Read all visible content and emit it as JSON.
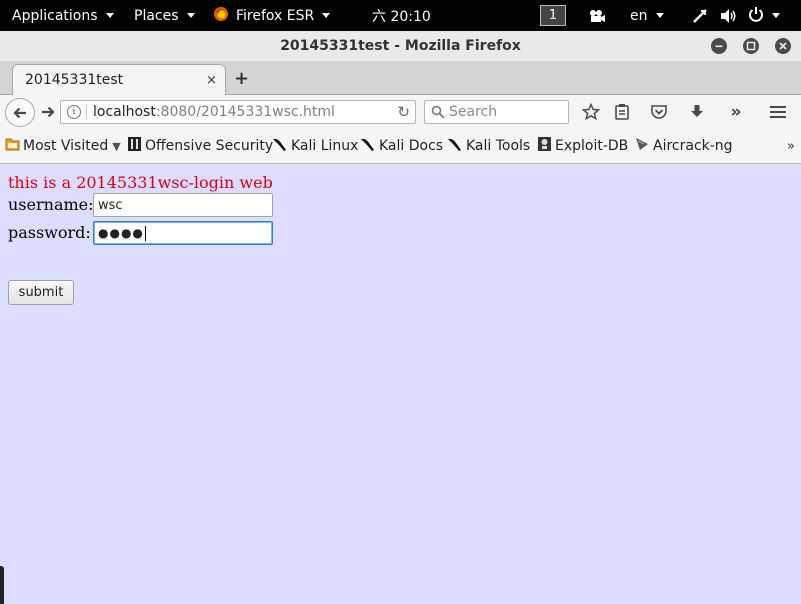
{
  "topbar": {
    "applications": "Applications",
    "places": "Places",
    "app_menu": "Firefox ESR",
    "clock": "六 20:10",
    "workspace": "1",
    "language": "en",
    "icons": [
      "firefox-icon",
      "camera-icon",
      "network-icon",
      "volume-icon",
      "power-icon"
    ]
  },
  "window": {
    "title": "20145331test - Mozilla Firefox",
    "controls": [
      "minimize-icon",
      "maximize-icon",
      "close-icon"
    ]
  },
  "tab": {
    "title": "20145331test",
    "close": "×",
    "new_tab": "+"
  },
  "navbar": {
    "url_host": "localhost",
    "url_rest": ":8080/20145331wsc.html",
    "search_placeholder": "Search",
    "icons": [
      "back-icon",
      "forward-icon",
      "info-icon",
      "reload-icon",
      "search-icon",
      "star-icon",
      "reading-list-icon",
      "pocket-icon",
      "download-icon",
      "overflow-icon",
      "hamburger-menu-icon"
    ],
    "overflow": "»"
  },
  "bookmarks": {
    "items": [
      "Most Visited",
      "Offensive Security",
      "Kali Linux",
      "Kali Docs",
      "Kali Tools",
      "Exploit-DB",
      "Aircrack-ng"
    ],
    "more": "»"
  },
  "page": {
    "heading": "this is a 20145331wsc-login web",
    "username_label": "username:",
    "username_value": "wsc",
    "password_label": "password:",
    "password_dots": "●●●●",
    "submit": "submit",
    "background": "#ddddff",
    "heading_color": "#e00012"
  }
}
